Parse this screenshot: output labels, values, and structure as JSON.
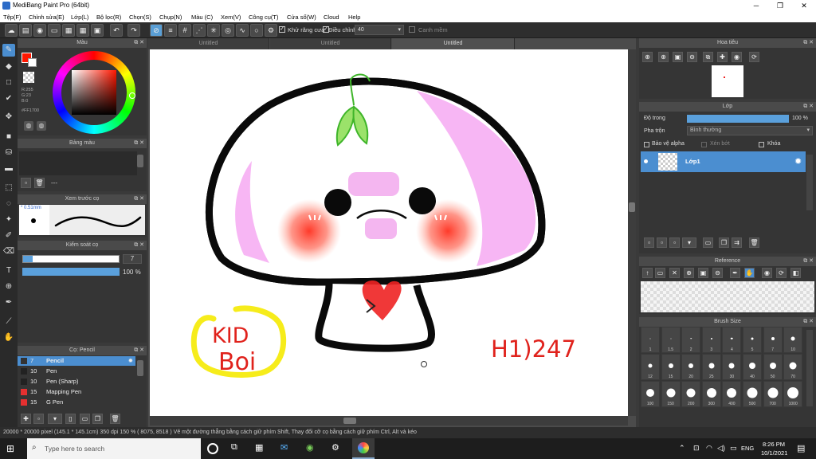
{
  "window": {
    "title": "MediBang Paint Pro (64bit)"
  },
  "menu": [
    "Tệp(F)",
    "Chỉnh sửa(E)",
    "Lớp(L)",
    "Bộ lọc(R)",
    "Chọn(S)",
    "Chụp(N)",
    "Màu (C)",
    "Xem(V)",
    "Công cụ(T)",
    "Cửa sổ(W)",
    "Cloud",
    "Help"
  ],
  "toolbar": {
    "antialias_label": "Khử răng cưa",
    "correction_label": "Điều chỉnh",
    "correction_value": "40",
    "snap_label": "Canh mềm"
  },
  "tabs": [
    "Untitled",
    "Untitled",
    "Untitled"
  ],
  "color_panel": {
    "title": "Màu",
    "r": "R:255",
    "g": "G:23",
    "b": "B:0",
    "hex": "#FF1700",
    "primary": "#ff1700"
  },
  "palette_panel": {
    "title": "Bảng màu",
    "label": "---"
  },
  "brush_preview": {
    "title": "Xem trước cọ",
    "size": "0.51mm"
  },
  "brush_control": {
    "title": "Kiểm soát cọ",
    "size": "7",
    "opacity": "100 %"
  },
  "brush_list": {
    "title": "Cọ: Pencil",
    "items": [
      {
        "size": "7",
        "name": "Pencil",
        "color": "#333333",
        "selected": true
      },
      {
        "size": "10",
        "name": "Pen",
        "color": "#222222"
      },
      {
        "size": "10",
        "name": "Pen (Sharp)",
        "color": "#222222"
      },
      {
        "size": "15",
        "name": "Mapping Pen",
        "color": "#e53030"
      },
      {
        "size": "15",
        "name": "G Pen",
        "color": "#e53030"
      }
    ]
  },
  "navigator": {
    "title": "Hoa tiêu"
  },
  "layer_panel": {
    "title": "Lớp",
    "opacity_label": "Độ trong",
    "opacity_value": "100 %",
    "blend_label": "Pha trộn",
    "blend_value": "Bình thường",
    "protect_alpha": "Bảo vệ alpha",
    "clipping": "Xén bớt",
    "lock": "Khóa",
    "layer_name": "Lớp1"
  },
  "reference": {
    "title": "Reference"
  },
  "brush_size": {
    "title": "Brush Size",
    "sizes": [
      "1",
      "1.5",
      "2",
      "3",
      "4",
      "5",
      "7",
      "10",
      "12",
      "15",
      "20",
      "25",
      "30",
      "40",
      "50",
      "70",
      "100",
      "150",
      "200",
      "300",
      "400",
      "500",
      "700",
      "1000"
    ]
  },
  "status": {
    "text": "20000 * 20000 pixel  (145.1 * 145.1cm)  350 dpi  150 %  ( 8075, 8518 )  Vẽ một đường thẳng bằng cách giữ phím Shift, Thay đổi cỡ cọ bằng cách giữ phím Ctrl, Alt và kéo"
  },
  "artwork": {
    "text1": "KID",
    "text2": "Boi",
    "signature": "H1)247"
  },
  "taskbar": {
    "search_placeholder": "Type here to search",
    "lang": "ENG",
    "time": "8:26 PM",
    "date": "10/1/2021"
  }
}
